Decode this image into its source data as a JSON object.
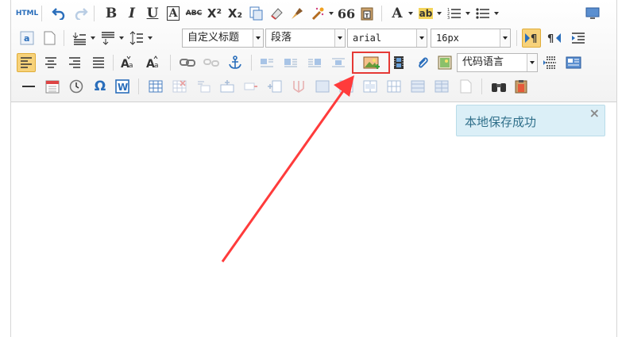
{
  "toolbar": {
    "row1": {
      "html_label": "HTML",
      "bold": "B",
      "italic": "I",
      "underline": "U",
      "strike_label": "ABC",
      "sup": "X²",
      "sub": "X₂",
      "quote": "66",
      "fontcolor": "A",
      "bgcolor": "ab"
    },
    "row2": {
      "custom_title": "自定义标题",
      "paragraph": "段落",
      "font_family": "arial",
      "font_size": "16px"
    },
    "row3": {
      "code_language": "代码语言"
    }
  },
  "toast": {
    "message": "本地保存成功",
    "close": "×"
  },
  "colors": {
    "highlight": "#e53935",
    "toast_bg": "#dbeff7",
    "active": "#f7d27a",
    "icon_blue": "#2a6ebb"
  }
}
